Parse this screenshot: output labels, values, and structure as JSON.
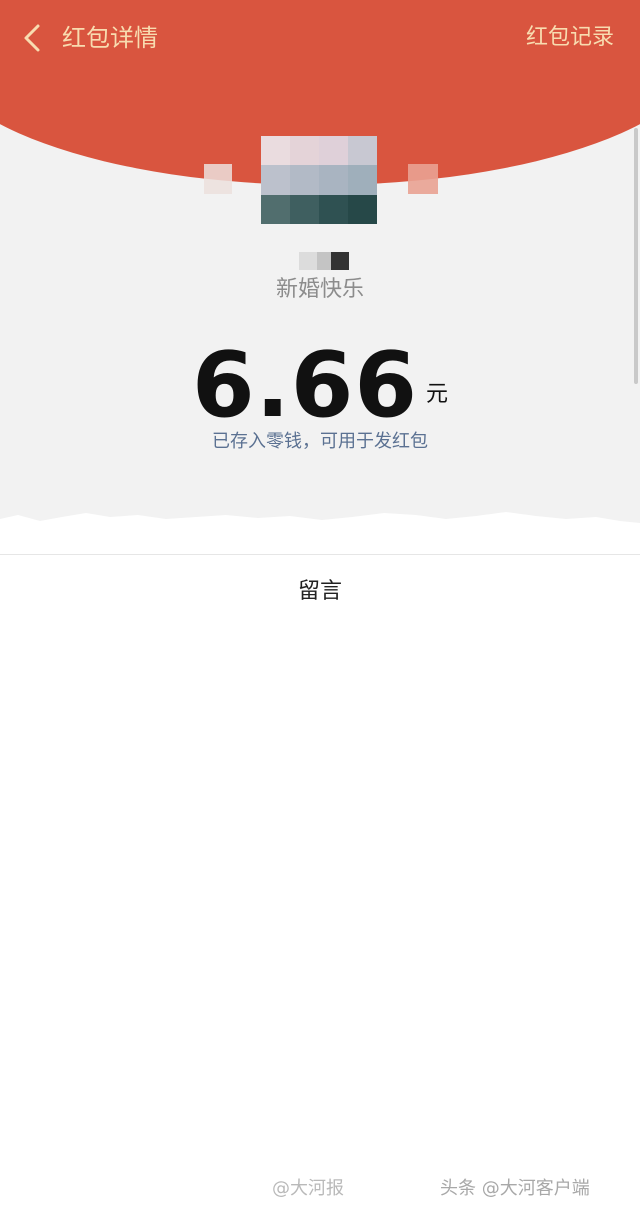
{
  "header": {
    "back_icon": "chevron-left-icon",
    "title": "红包详情",
    "record_link": "红包记录",
    "text_color": "#f8dcb0",
    "bg_color": "#d9553f"
  },
  "packet": {
    "greeting": "新婚快乐",
    "amount": "6.66",
    "unit": "元",
    "saved_note": "已存入零钱，可用于发红包"
  },
  "messages": {
    "label": "留言"
  },
  "watermarks": {
    "weibo": "@大河报",
    "toutiao": "头条 @大河客户端"
  }
}
